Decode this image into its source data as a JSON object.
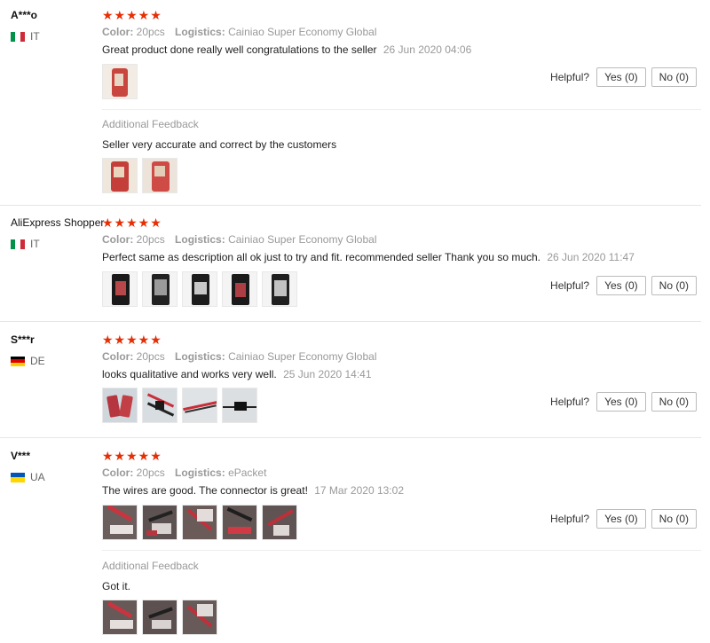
{
  "labels": {
    "color": "Color:",
    "logistics": "Logistics:",
    "helpful": "Helpful?",
    "additional": "Additional Feedback"
  },
  "reviews": [
    {
      "user": "A***o",
      "country": "IT",
      "rating": 5,
      "stars": "★★★★★",
      "color": "20pcs",
      "logistics": "Cainiao Super Economy Global",
      "text": "Great product done really well congratulations to the seller",
      "date": "26 Jun 2020 04:06",
      "yes": "Yes (0)",
      "no": "No (0)",
      "additional_text": "Seller very accurate and correct by the customers"
    },
    {
      "user": "AliExpress Shopper",
      "country": "IT",
      "rating": 5,
      "stars": "★★★★★",
      "color": "20pcs",
      "logistics": "Cainiao Super Economy Global",
      "text": "Perfect same as description all ok just to try and fit. recommended seller Thank you so much.",
      "date": "26 Jun 2020 11:47",
      "yes": "Yes (0)",
      "no": "No (0)"
    },
    {
      "user": "S***r",
      "country": "DE",
      "rating": 5,
      "stars": "★★★★★",
      "color": "20pcs",
      "logistics": "Cainiao Super Economy Global",
      "text": "looks qualitative and works very well.",
      "date": "25 Jun 2020 14:41",
      "yes": "Yes (0)",
      "no": "No (0)"
    },
    {
      "user": "V***",
      "country": "UA",
      "rating": 5,
      "stars": "★★★★★",
      "color": "20pcs",
      "logistics": "ePacket",
      "text": "The wires are good. The connector is great!",
      "date": "17 Mar 2020 13:02",
      "yes": "Yes (0)",
      "no": "No (0)",
      "additional_text": "Got it."
    }
  ],
  "colors": {
    "star": "#e62e04",
    "muted": "#999999",
    "border": "#e6e6e6"
  }
}
